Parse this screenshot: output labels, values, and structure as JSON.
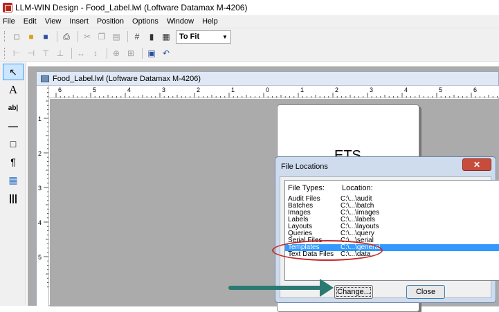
{
  "window": {
    "title": "LLM-WIN Design - Food_Label.lwl (Loftware Datamax M-4206)"
  },
  "menu": [
    {
      "label": "File"
    },
    {
      "label": "Edit"
    },
    {
      "label": "View"
    },
    {
      "label": "Insert"
    },
    {
      "label": "Position"
    },
    {
      "label": "Options"
    },
    {
      "label": "Window"
    },
    {
      "label": "Help"
    }
  ],
  "toolbar": {
    "zoom_value": "To Fit"
  },
  "document": {
    "title": "Food_Label.lwl (Loftware Datamax M-4206)",
    "label_text": "ETS"
  },
  "ruler": {
    "h_ticks": [
      "6",
      "5",
      "4",
      "3",
      "2",
      "1",
      "0",
      "1",
      "2",
      "3",
      "4",
      "5",
      "6"
    ],
    "v_ticks": [
      "1",
      "2",
      "3",
      "4",
      "5"
    ]
  },
  "dialog": {
    "title": "File Locations",
    "col_types": "File Types:",
    "col_location": "Location:",
    "rows": [
      {
        "type": "Audit Files",
        "location": "C:\\...\\audit"
      },
      {
        "type": "Batches",
        "location": "C:\\...\\batch"
      },
      {
        "type": "Images",
        "location": "C:\\...\\images"
      },
      {
        "type": "Labels",
        "location": "C:\\...\\labels"
      },
      {
        "type": "Layouts",
        "location": "C:\\...\\layouts"
      },
      {
        "type": "Queries",
        "location": "C:\\...\\query"
      },
      {
        "type": "Serial Files",
        "location": "C:\\...\\serial"
      },
      {
        "type": "Templates",
        "location": "C:\\...\\general"
      },
      {
        "type": "Text Data Files",
        "location": "C:\\...\\data"
      }
    ],
    "selected_row": 7,
    "change_label": "Change...",
    "close_label": "Close"
  },
  "colors": {
    "selection": "#3399ff",
    "highlight_oval": "#c62828",
    "arrow": "#2a7a72"
  }
}
